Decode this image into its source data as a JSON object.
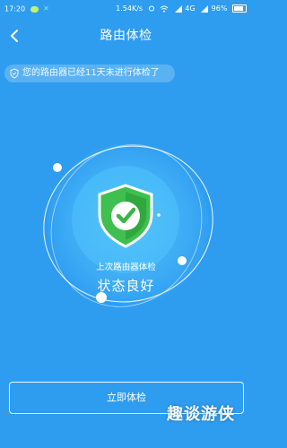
{
  "status_bar": {
    "time": "17:20",
    "net_speed": "1.54K/s",
    "network_type": "4G",
    "battery": "96%"
  },
  "header": {
    "title": "路由体检",
    "back_icon": "chevron-left-icon"
  },
  "notice": {
    "icon": "shield-outline-icon",
    "text": "您的路由器已经11天未进行体检了"
  },
  "checkup": {
    "last_check_label": "上次路由器体检",
    "status": "状态良好",
    "shield_icon": "shield-check-icon",
    "shield_color": "#3bb54a"
  },
  "actions": {
    "start_check_label": "立即体检"
  },
  "watermark": {
    "text": "趣谈游侠"
  },
  "colors": {
    "background": "#2e9df0",
    "accent": "#3bb54a"
  }
}
